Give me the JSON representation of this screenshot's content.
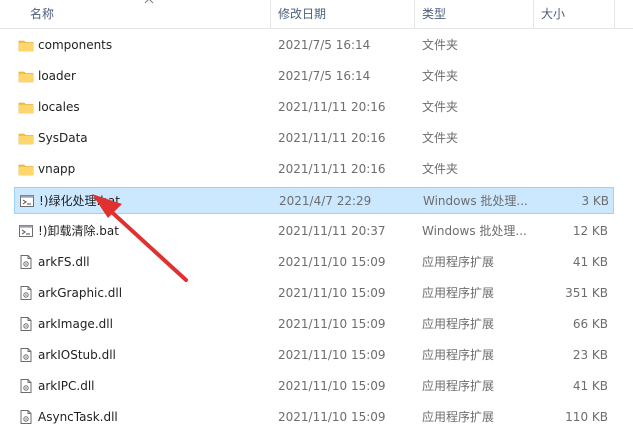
{
  "columns": {
    "name": "名称",
    "date": "修改日期",
    "type": "类型",
    "size": "大小"
  },
  "colors": {
    "accent_arrow": "#e03131",
    "folder": "#f5c242",
    "selection": "#cce8ff"
  },
  "files": [
    {
      "name": "components",
      "date": "2021/7/5 16:14",
      "type": "文件夹",
      "size": "",
      "icon": "folder-icon"
    },
    {
      "name": "loader",
      "date": "2021/7/5 16:14",
      "type": "文件夹",
      "size": "",
      "icon": "folder-icon"
    },
    {
      "name": "locales",
      "date": "2021/11/11 20:16",
      "type": "文件夹",
      "size": "",
      "icon": "folder-icon"
    },
    {
      "name": "SysData",
      "date": "2021/11/11 20:16",
      "type": "文件夹",
      "size": "",
      "icon": "folder-icon"
    },
    {
      "name": "vnapp",
      "date": "2021/11/11 20:16",
      "type": "文件夹",
      "size": "",
      "icon": "folder-icon"
    },
    {
      "name": "!)绿化处理.bat",
      "date": "2021/4/7 22:29",
      "type": "Windows 批处理...",
      "size": "3 KB",
      "icon": "batch-file-icon",
      "selected": true
    },
    {
      "name": "!)卸载清除.bat",
      "date": "2021/11/11 20:37",
      "type": "Windows 批处理...",
      "size": "12 KB",
      "icon": "batch-file-icon"
    },
    {
      "name": "arkFS.dll",
      "date": "2021/11/10 15:09",
      "type": "应用程序扩展",
      "size": "41 KB",
      "icon": "dll-file-icon"
    },
    {
      "name": "arkGraphic.dll",
      "date": "2021/11/10 15:09",
      "type": "应用程序扩展",
      "size": "351 KB",
      "icon": "dll-file-icon"
    },
    {
      "name": "arkImage.dll",
      "date": "2021/11/10 15:09",
      "type": "应用程序扩展",
      "size": "66 KB",
      "icon": "dll-file-icon"
    },
    {
      "name": "arkIOStub.dll",
      "date": "2021/11/10 15:09",
      "type": "应用程序扩展",
      "size": "23 KB",
      "icon": "dll-file-icon"
    },
    {
      "name": "arkIPC.dll",
      "date": "2021/11/10 15:09",
      "type": "应用程序扩展",
      "size": "41 KB",
      "icon": "dll-file-icon"
    },
    {
      "name": "AsyncTask.dll",
      "date": "2021/11/10 15:09",
      "type": "应用程序扩展",
      "size": "110 KB",
      "icon": "dll-file-icon"
    }
  ]
}
